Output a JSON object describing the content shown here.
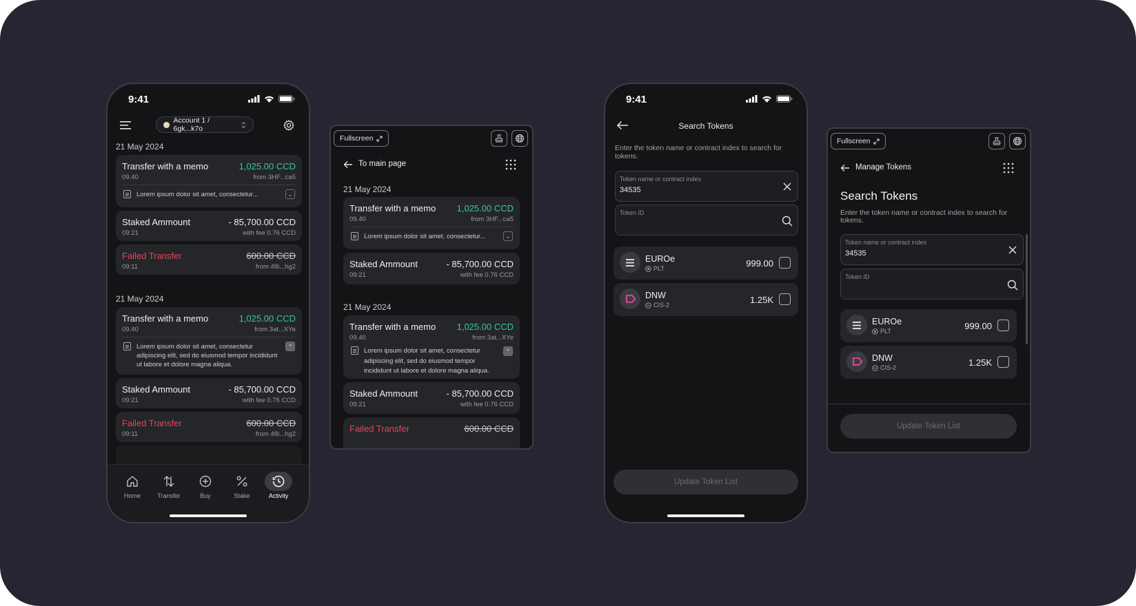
{
  "status_time": "9:41",
  "activity_phone": {
    "account": "Account 1 / 6gk...k7o",
    "groups": [
      {
        "date": "21 May 2024",
        "items": [
          {
            "title": "Transfer with a memo",
            "amount": "1,025.00 CCD",
            "time": "09.40",
            "detail": "from 3HF...ca5",
            "memo": "Lorem ipsum dolor sit amet, consectetur..."
          },
          {
            "title": "Staked Ammount",
            "amount": "- 85,700.00 CCD",
            "time": "09:21",
            "detail": "with fee 0.76 CCD"
          },
          {
            "title": "Failed Transfer",
            "amount": "600.00 CCD",
            "time": "09:11",
            "detail": "from 48i...hg2"
          }
        ]
      },
      {
        "date": "21 May 2024",
        "items": [
          {
            "title": "Transfer with a memo",
            "amount": "1,025.00 CCD",
            "time": "09.40",
            "detail": "from 3at...XYe",
            "memo": "Lorem ipsum dolor sit amet, consectetur adipiscing elit, sed do eiusmod tempor incididunt ut labore et dolore magna aliqua."
          },
          {
            "title": "Staked Ammount",
            "amount": "- 85,700.00 CCD",
            "time": "09:21",
            "detail": "with fee 0.76 CCD"
          },
          {
            "title": "Failed Transfer",
            "amount": "600.00 CCD",
            "time": "09:11",
            "detail": "from 48i...hg2"
          }
        ]
      }
    ],
    "nav": [
      {
        "label": "Home",
        "icon": "home-icon"
      },
      {
        "label": "Transfer",
        "icon": "transfer-icon"
      },
      {
        "label": "Buy",
        "icon": "buy-icon"
      },
      {
        "label": "Stake",
        "icon": "stake-icon"
      },
      {
        "label": "Activity",
        "icon": "activity-icon"
      }
    ]
  },
  "activity_panel": {
    "fullscreen_label": "Fullscreen",
    "back_label": "To main page",
    "groups": [
      {
        "date": "21 May 2024",
        "items": [
          {
            "title": "Transfer with a memo",
            "amount": "1,025.00 CCD",
            "time": "09.40",
            "detail": "from 3HF...ca5",
            "memo": "Lorem ipsum dolor sit amet, consectetur..."
          },
          {
            "title": "Staked Ammount",
            "amount": "- 85,700.00 CCD",
            "time": "09:21",
            "detail": "with fee 0.76 CCD"
          }
        ]
      },
      {
        "date": "21 May 2024",
        "items": [
          {
            "title": "Transfer with a memo",
            "amount": "1,025.00 CCD",
            "time": "09.40",
            "detail": "from 3at...XYe",
            "memo": "Lorem ipsum dolor sit amet, consectetur adipiscing elit, sed do eiusmod tempor incididunt ut labore et dolore magna aliqua."
          },
          {
            "title": "Staked Ammount",
            "amount": "- 85,700.00 CCD",
            "time": "09:21",
            "detail": "with fee 0.76 CCD"
          },
          {
            "title": "Failed Transfer",
            "amount": "600.00 CCD"
          }
        ]
      }
    ]
  },
  "search_phone": {
    "title": "Search Tokens",
    "description": "Enter the token name or contract index to search for tokens.",
    "field1_label": "Token name or contract index",
    "field1_value": "34535",
    "field2_label": "Token ID",
    "tokens": [
      {
        "name": "EUROe",
        "type": "PLT",
        "balance": "999.00"
      },
      {
        "name": "DNW",
        "type": "CIS-2",
        "balance": "1.25K"
      }
    ],
    "button": "Update Token List"
  },
  "search_panel": {
    "fullscreen_label": "Fullscreen",
    "back_label": "Manage Tokens",
    "title": "Search Tokens",
    "description": "Enter the token name or contract index to search for tokens.",
    "field1_label": "Token name or contract index",
    "field1_value": "34535",
    "field2_label": "Token ID",
    "tokens": [
      {
        "name": "EUROe",
        "type": "PLT",
        "balance": "999.00"
      },
      {
        "name": "DNW",
        "type": "CIS-2",
        "balance": "1.25K"
      }
    ],
    "button": "Update Token List"
  },
  "colors": {
    "background": "#252631",
    "surface": "#141416",
    "card": "#25262a",
    "positive": "#33c7a4",
    "negative": "#e1455a",
    "dnw_accent": "#d0468a"
  }
}
